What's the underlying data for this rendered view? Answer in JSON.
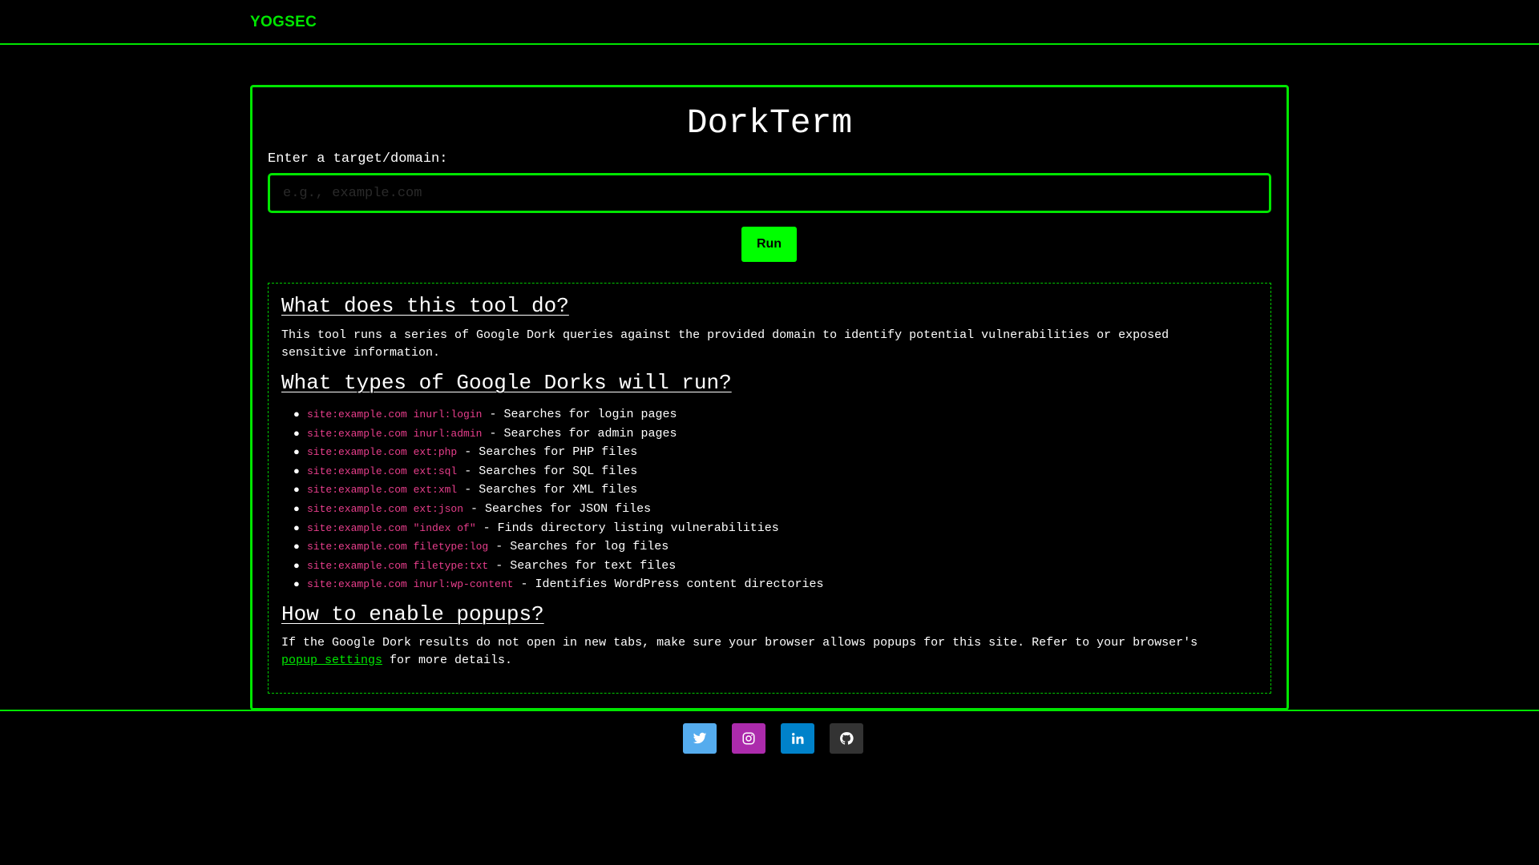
{
  "navbar": {
    "brand": "YOGSEC"
  },
  "main": {
    "title": "DorkTerm",
    "input_label": "Enter a target/domain:",
    "input_placeholder": "e.g., example.com",
    "input_value": "",
    "run_label": "Run"
  },
  "info": {
    "section1": {
      "heading": "What does this tool do?",
      "text": "This tool runs a series of Google Dork queries against the provided domain to identify potential vulnerabilities or exposed sensitive information."
    },
    "section2": {
      "heading": "What types of Google Dorks will run?",
      "dorks": [
        {
          "query": "site:example.com inurl:login",
          "desc": " - Searches for login pages"
        },
        {
          "query": "site:example.com inurl:admin",
          "desc": " - Searches for admin pages"
        },
        {
          "query": "site:example.com ext:php",
          "desc": " - Searches for PHP files"
        },
        {
          "query": "site:example.com ext:sql",
          "desc": " - Searches for SQL files"
        },
        {
          "query": "site:example.com ext:xml",
          "desc": " - Searches for XML files"
        },
        {
          "query": "site:example.com ext:json",
          "desc": " - Searches for JSON files"
        },
        {
          "query": "site:example.com \"index of\"",
          "desc": " - Finds directory listing vulnerabilities"
        },
        {
          "query": "site:example.com filetype:log",
          "desc": " - Searches for log files"
        },
        {
          "query": "site:example.com filetype:txt",
          "desc": " - Searches for text files"
        },
        {
          "query": "site:example.com inurl:wp-content",
          "desc": " - Identifies WordPress content directories"
        }
      ]
    },
    "section3": {
      "heading": "How to enable popups?",
      "text_before": "If the Google Dork results do not open in new tabs, make sure your browser allows popups for this site. Refer to your browser's ",
      "link_text": "popup settings",
      "text_after": " for more details."
    }
  },
  "footer": {
    "social": [
      {
        "name": "twitter-icon",
        "color": "#55acee"
      },
      {
        "name": "instagram-icon",
        "color": "#ac2bac"
      },
      {
        "name": "linkedin-icon",
        "color": "#0082ca"
      },
      {
        "name": "github-icon",
        "color": "#333333"
      }
    ]
  }
}
